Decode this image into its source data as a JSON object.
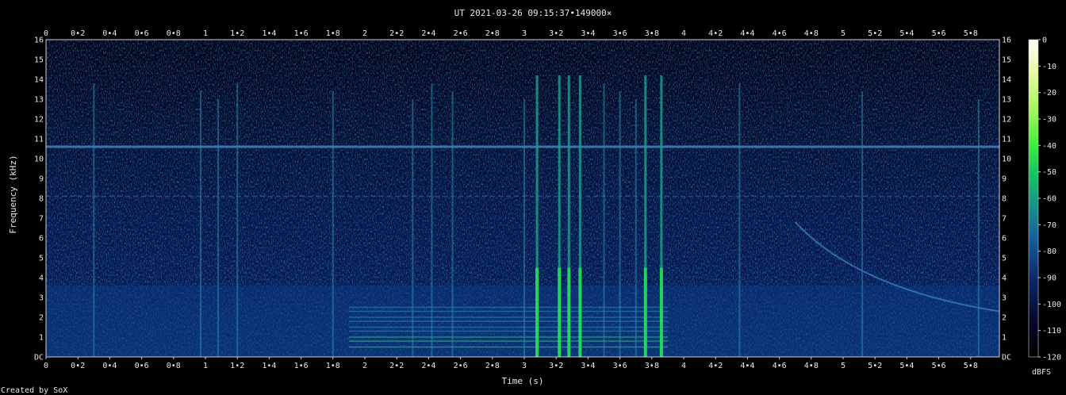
{
  "chart_data": {
    "type": "heatmap",
    "title": "UT 2021-03-26 09:15:37•149000×",
    "xlabel": "Time (s)",
    "ylabel": "Frequency (kHz)",
    "xlim": [
      0,
      5.98
    ],
    "ylim": [
      0,
      16
    ],
    "x_ticks": [
      "0",
      "0•2",
      "0•4",
      "0•6",
      "0•8",
      "1",
      "1•2",
      "1•4",
      "1•6",
      "1•8",
      "2",
      "2•2",
      "2•4",
      "2•6",
      "2•8",
      "3",
      "3•2",
      "3•4",
      "3•6",
      "3•8",
      "4",
      "4•2",
      "4•4",
      "4•6",
      "4•8",
      "5",
      "5•2",
      "5•4",
      "5•6",
      "5•8"
    ],
    "y_ticks": [
      "DC",
      "1",
      "2",
      "3",
      "4",
      "5",
      "6",
      "7",
      "8",
      "9",
      "10",
      "11",
      "12",
      "13",
      "14",
      "15",
      "16"
    ],
    "colorbar": {
      "label": "dBFS",
      "range": [
        -120,
        0
      ],
      "ticks": [
        "0",
        "-10",
        "-20",
        "-30",
        "-40",
        "-50",
        "-60",
        "-70",
        "-80",
        "-90",
        "-100",
        "-110",
        "-120"
      ]
    },
    "colors": {
      "background": "#000000",
      "plot_background": "#020e3a",
      "hum_line": "#3e7fb8",
      "strong": "#22e05a"
    },
    "features": {
      "hum_line_khz": 10.6,
      "faint_line_khz": 8.1,
      "burst_region_s": [
        1.9,
        3.9
      ],
      "burst_harmonic_khz": [
        0.5,
        0.8,
        1.0,
        1.3,
        1.5,
        1.8,
        2.0,
        2.3,
        2.5
      ],
      "strong_transients_s": [
        3.08,
        3.22,
        3.28,
        3.35,
        3.76,
        3.86
      ],
      "transients_s": [
        0.3,
        0.97,
        1.08,
        1.2,
        1.8,
        2.3,
        2.42,
        2.55,
        3.0,
        3.5,
        3.6,
        3.7,
        4.35,
        5.12,
        5.85
      ],
      "descending_chirp": {
        "start_s": 4.7,
        "start_khz": 6.8,
        "end_s": 5.98,
        "end_khz": 2.3
      }
    }
  },
  "footer": {
    "credit": "Created by SoX"
  }
}
